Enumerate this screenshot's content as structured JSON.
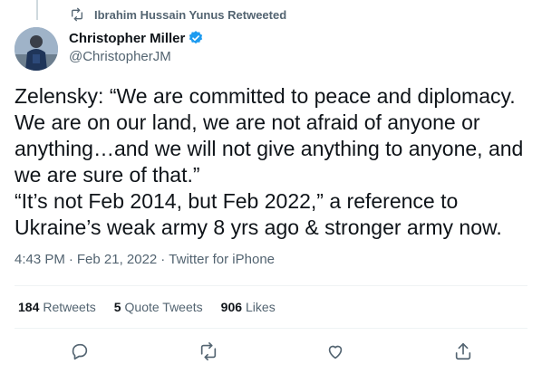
{
  "retweet_header": {
    "text": "Ibrahim Hussain Yunus Retweeted"
  },
  "author": {
    "name": "Christopher Miller",
    "handle": "@ChristopherJM",
    "verified": true
  },
  "tweet": {
    "text": "Zelensky: “We are committed to peace and diplomacy.\nWe are on our land, we are not afraid of anyone or\nanything…and we will not give anything to anyone, and\nwe are sure of that.”\n“It’s not Feb 2014, but Feb 2022,” a reference to\nUkraine’s weak army 8 yrs ago & stronger army now.",
    "time": "4:43 PM",
    "date": "Feb 21, 2022",
    "source": "Twitter for iPhone"
  },
  "stats": {
    "retweets_count": "184",
    "retweets_label": "Retweets",
    "quotes_count": "5",
    "quotes_label": "Quote Tweets",
    "likes_count": "906",
    "likes_label": "Likes"
  },
  "actions": {
    "icons": [
      "reply-icon",
      "retweet-icon",
      "like-icon",
      "share-icon"
    ]
  },
  "colors": {
    "text": "#0f1419",
    "secondary": "#536471",
    "verified": "#1d9bf0",
    "divider": "#eff3f4"
  }
}
